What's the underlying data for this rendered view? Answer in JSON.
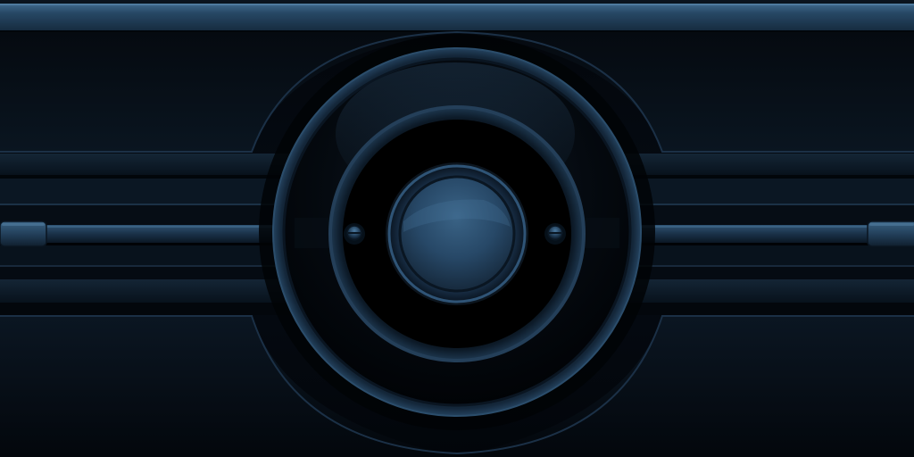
{
  "theme": {
    "background": "#03070c",
    "panel_dark": "#060d15",
    "panel_mid": "#0c1824",
    "steel_blue": "#23405b",
    "highlight_blue": "#3c6b91",
    "button_face": "#2a4a68",
    "edge_line": "#1a2f44"
  },
  "controls": {
    "center_button": {
      "icon": "round-button-icon"
    },
    "left_indicator": {
      "icon": "rivet-icon"
    },
    "right_indicator": {
      "icon": "rivet-icon"
    },
    "left_handle": {
      "icon": "rail-handle-icon"
    },
    "right_handle": {
      "icon": "rail-handle-icon"
    }
  }
}
